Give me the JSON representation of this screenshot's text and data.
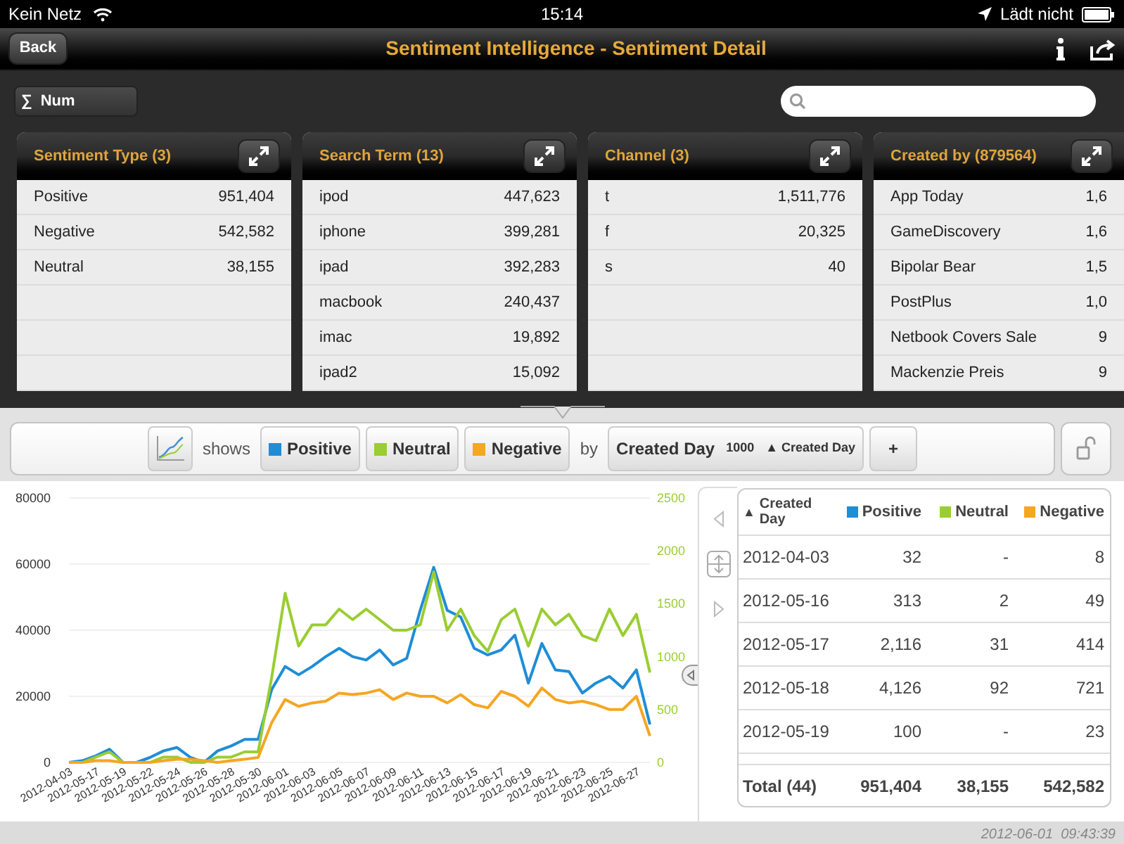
{
  "status_bar": {
    "carrier": "Kein Netz",
    "time": "15:14",
    "charging": "Lädt nicht"
  },
  "nav_bar": {
    "back": "Back",
    "title": "Sentiment Intelligence - Sentiment Detail"
  },
  "measure_button": {
    "symbol": "∑",
    "label": "Num"
  },
  "cards": [
    {
      "title": "Sentiment Type (3)",
      "rows": [
        [
          "Positive",
          "951,404"
        ],
        [
          "Negative",
          "542,582"
        ],
        [
          "Neutral",
          "38,155"
        ],
        [
          "",
          ""
        ],
        [
          "",
          ""
        ],
        [
          "",
          ""
        ]
      ]
    },
    {
      "title": "Search Term (13)",
      "rows": [
        [
          "ipod",
          "447,623"
        ],
        [
          "iphone",
          "399,281"
        ],
        [
          "ipad",
          "392,283"
        ],
        [
          "macbook",
          "240,437"
        ],
        [
          "imac",
          "19,892"
        ],
        [
          "ipad2",
          "15,092"
        ]
      ]
    },
    {
      "title": "Channel (3)",
      "rows": [
        [
          "t",
          "1,511,776"
        ],
        [
          "f",
          "20,325"
        ],
        [
          "s",
          "40"
        ],
        [
          "",
          ""
        ],
        [
          "",
          ""
        ],
        [
          "",
          ""
        ]
      ]
    },
    {
      "title": "Created by (879564)",
      "rows": [
        [
          "App Today",
          "1,6"
        ],
        [
          "GameDiscovery",
          "1,6"
        ],
        [
          "Bipolar Bear",
          "1,5"
        ],
        [
          "PostPlus",
          "1,0"
        ],
        [
          "Netbook Covers Sale",
          "9"
        ],
        [
          "Mackenzie Preis",
          "9"
        ]
      ]
    }
  ],
  "toolbar": {
    "shows": "shows",
    "by": "by",
    "dimension": "Created Day",
    "limit": "1000",
    "sort": "▲ Created Day",
    "add": "+"
  },
  "chart": {
    "chart_data": {
      "type": "line",
      "categories": [
        "2012-04-03",
        null,
        "2012-05-17",
        null,
        "2012-05-19",
        null,
        "2012-05-22",
        null,
        "2012-05-24",
        null,
        "2012-05-26",
        null,
        "2012-05-28",
        null,
        "2012-05-30",
        null,
        "2012-06-01",
        null,
        "2012-06-03",
        null,
        "2012-06-05",
        null,
        "2012-06-07",
        null,
        "2012-06-09",
        null,
        "2012-06-11",
        null,
        "2012-06-13",
        null,
        "2012-06-15",
        null,
        "2012-06-17",
        null,
        "2012-06-19",
        null,
        "2012-06-21",
        null,
        "2012-06-23",
        null,
        "2012-06-25",
        null,
        "2012-06-27",
        null
      ],
      "grid": true,
      "ylim": [
        0,
        80000
      ],
      "yticks": [
        0,
        20000,
        40000,
        60000,
        80000
      ],
      "y2lim": [
        0,
        2500
      ],
      "y2ticks": [
        0,
        500,
        1000,
        1500,
        2000,
        2500
      ],
      "series": [
        {
          "name": "Positive",
          "color": "#1f8dd6",
          "values": [
            0,
            500,
            2000,
            4000,
            0,
            0,
            1500,
            3500,
            4500,
            1500,
            0,
            3500,
            5000,
            7000,
            7000,
            22000,
            29000,
            26500,
            29000,
            32000,
            34500,
            32000,
            31000,
            34000,
            29500,
            31500,
            46000,
            59000,
            46000,
            44000,
            34500,
            32500,
            34000,
            38500,
            24000,
            36000,
            28000,
            27500,
            21000,
            24000,
            26000,
            22500,
            28000,
            11500
          ]
        },
        {
          "name": "Neutral",
          "color": "#9acd32",
          "axis": "y2",
          "values": [
            0,
            0,
            50,
            100,
            0,
            0,
            0,
            50,
            50,
            0,
            0,
            50,
            50,
            100,
            100,
            800,
            1600,
            1100,
            1300,
            1300,
            1450,
            1350,
            1450,
            1350,
            1250,
            1250,
            1300,
            1800,
            1250,
            1450,
            1200,
            1050,
            1350,
            1450,
            1100,
            1450,
            1300,
            1400,
            1200,
            1150,
            1450,
            1200,
            1400,
            850
          ]
        },
        {
          "name": "Negative",
          "color": "#f5a623",
          "values": [
            0,
            0,
            500,
            500,
            0,
            0,
            0,
            500,
            1000,
            1000,
            500,
            0,
            500,
            1000,
            1500,
            12000,
            19000,
            17000,
            18000,
            18500,
            21000,
            20500,
            21000,
            22000,
            19000,
            21000,
            20000,
            20000,
            18000,
            20500,
            17500,
            16500,
            21500,
            20000,
            17000,
            22500,
            19000,
            18000,
            18500,
            17500,
            16000,
            16000,
            20000,
            8000
          ]
        }
      ]
    }
  },
  "table": {
    "columns": [
      {
        "label": "Created Day",
        "sort": "▲"
      },
      {
        "label": "Positive",
        "color": "#1f8dd6"
      },
      {
        "label": "Neutral",
        "color": "#9acd32"
      },
      {
        "label": "Negative",
        "color": "#f5a623"
      }
    ],
    "rows": [
      [
        "2012-04-03",
        "32",
        "-",
        "8"
      ],
      [
        "2012-05-16",
        "313",
        "2",
        "49"
      ],
      [
        "2012-05-17",
        "2,116",
        "31",
        "414"
      ],
      [
        "2012-05-18",
        "4,126",
        "92",
        "721"
      ],
      [
        "2012-05-19",
        "100",
        "-",
        "23"
      ]
    ],
    "total": [
      "Total (44)",
      "951,404",
      "38,155",
      "542,582"
    ]
  },
  "timestamp": "2012-06-01  09:43:39"
}
